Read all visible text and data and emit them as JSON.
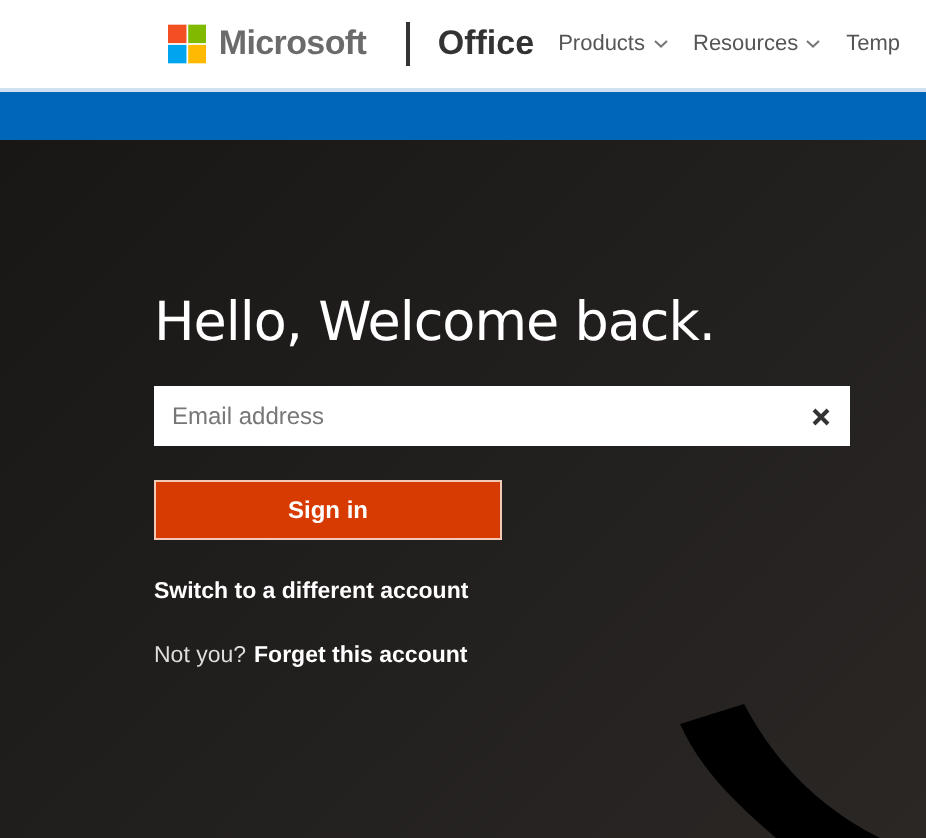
{
  "header": {
    "brand": "Microsoft",
    "product": "Office",
    "nav": [
      {
        "label": "Products",
        "dropdown": true
      },
      {
        "label": "Resources",
        "dropdown": true
      },
      {
        "label": "Temp",
        "dropdown": false
      }
    ]
  },
  "signin": {
    "heading": "Hello, Welcome back.",
    "email_field": {
      "placeholder": "Email address"
    },
    "sign_in_button": "Sign in",
    "switch_link": "Switch to a different account",
    "not_you": "Not you?",
    "forget_link": "Forget this account"
  }
}
